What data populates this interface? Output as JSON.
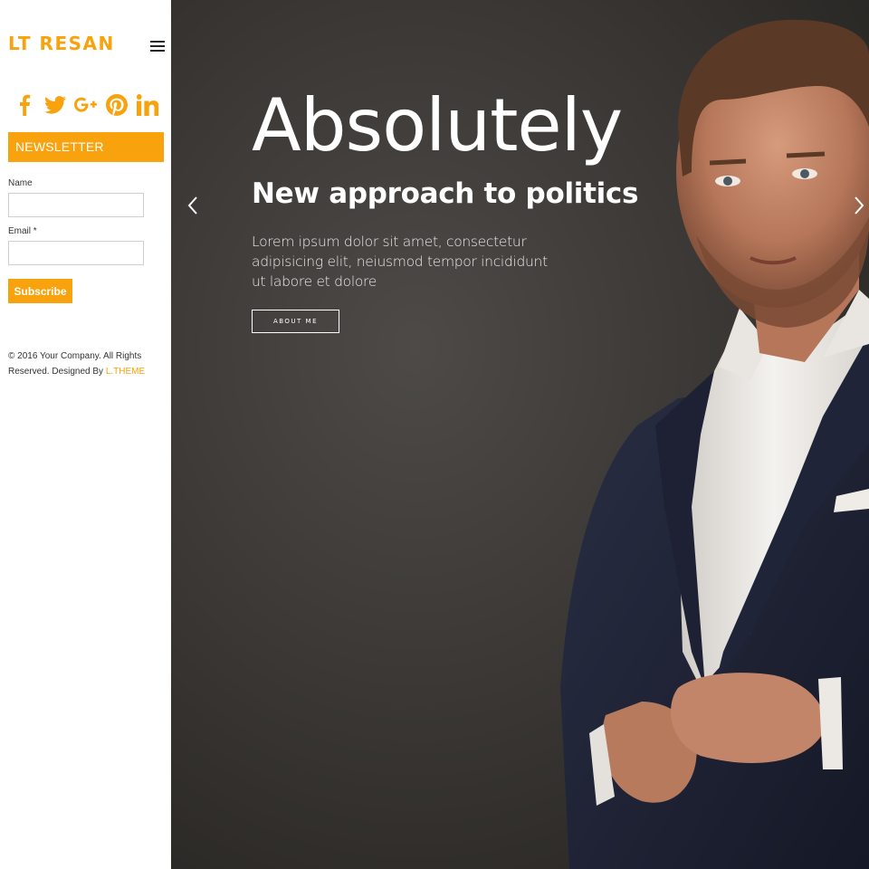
{
  "sidebar": {
    "logo": "LT RESAN",
    "social_icons": [
      "facebook-icon",
      "twitter-icon",
      "google-plus-icon",
      "pinterest-icon",
      "linkedin-icon"
    ],
    "newsletter": {
      "title": "NEWSLETTER",
      "name_label": "Name",
      "name_value": "",
      "email_label": "Email *",
      "email_value": "",
      "subscribe_label": "Subscribe"
    },
    "footer": {
      "text": "© 2016 Your Company. All Rights Reserved. Designed By ",
      "link_text": "L.THEME"
    }
  },
  "hero": {
    "title": "Absolutely",
    "subtitle": "New approach to politics",
    "text": "Lorem ipsum dolor sit amet, consectetur adipisicing elit, neiusmod tempor incididunt ut labore et dolore",
    "button_label": "ABOUT ME"
  },
  "colors": {
    "accent": "#f8a20d",
    "hero_background": "#3b3835",
    "text_light": "#ffffff"
  }
}
